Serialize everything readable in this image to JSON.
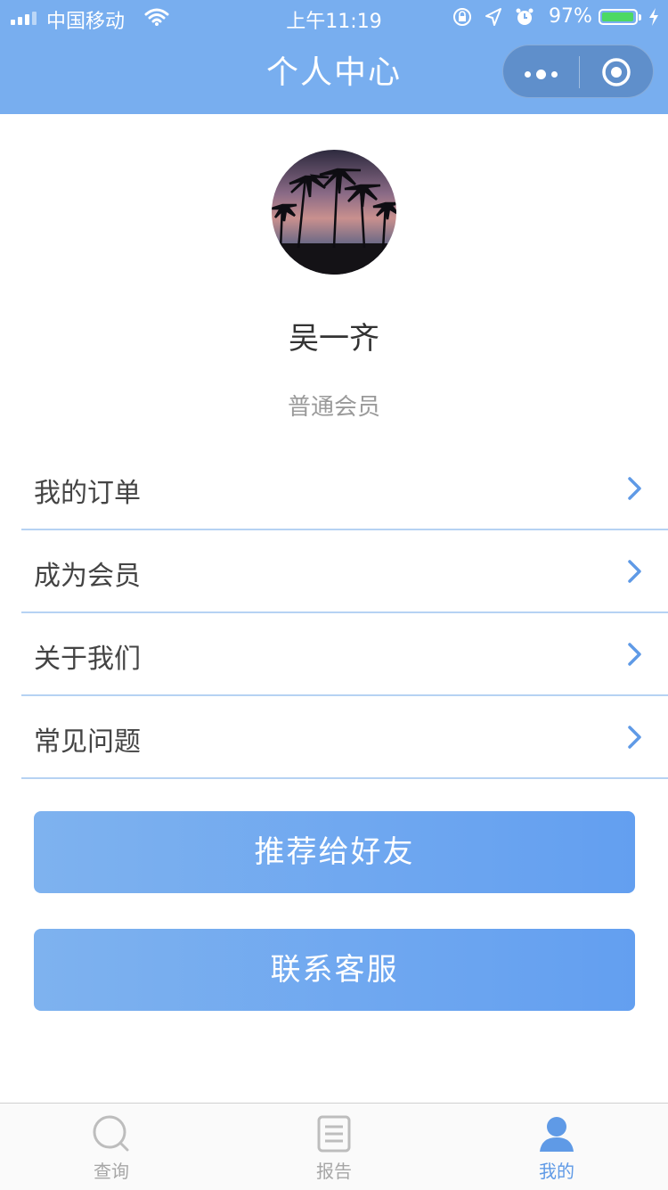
{
  "status_bar": {
    "carrier": "中国移动",
    "time": "上午11:19",
    "battery": "97%",
    "battery_level": 0.97
  },
  "nav": {
    "title": "个人中心",
    "more_icon": "more-dots-icon",
    "close_icon": "target-circle-icon"
  },
  "profile": {
    "name": "吴一齐",
    "level": "普通会员"
  },
  "menu": [
    {
      "label": "我的订单"
    },
    {
      "label": "成为会员"
    },
    {
      "label": "关于我们"
    },
    {
      "label": "常见问题"
    }
  ],
  "buttons": {
    "recommend": "推荐给好友",
    "contact": "联系客服"
  },
  "tabbar": [
    {
      "label": "查询",
      "icon": "search-icon"
    },
    {
      "label": "报告",
      "icon": "report-icon"
    },
    {
      "label": "我的",
      "icon": "user-icon",
      "active": true
    }
  ],
  "colors": {
    "header": "#78aeef",
    "accent": "#639ff0",
    "divider": "#b6d2f3"
  }
}
